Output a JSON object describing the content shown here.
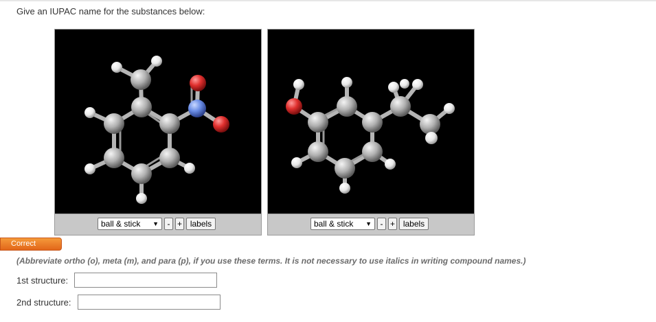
{
  "question": "Give an IUPAC name for the substances below:",
  "viewers": [
    {
      "style_value": "ball & stick",
      "minus_label": "-",
      "plus_label": "+",
      "labels_label": "labels"
    },
    {
      "style_value": "ball & stick",
      "minus_label": "-",
      "plus_label": "+",
      "labels_label": "labels"
    }
  ],
  "status_badge": "Correct",
  "hint": "(Abbreviate ortho (o), meta (m), and para (p), if you use these terms. It is not necessary to use italics in writing compound names.)",
  "fields": [
    {
      "label": "1st structure:",
      "value": ""
    },
    {
      "label": "2nd structure:",
      "value": ""
    }
  ],
  "colors": {
    "carbon": "#b8b8b8",
    "hydrogen": "#f2f2f2",
    "oxygen": "#e0302e",
    "nitrogen": "#6b8ee6",
    "badge": "#ee7d2a"
  }
}
